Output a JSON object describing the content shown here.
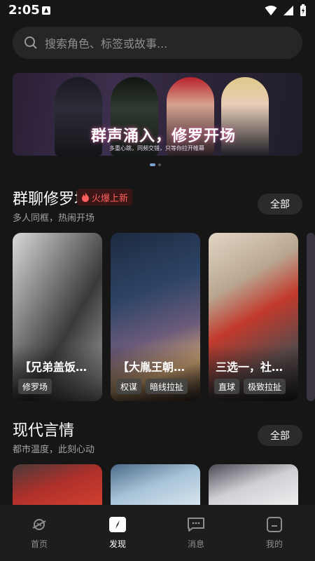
{
  "status": {
    "time": "2:05"
  },
  "search": {
    "placeholder": "搜索角色、标签或故事..."
  },
  "banner": {
    "title": "群声涌入，修罗开场",
    "subtitle": "多重心跳，同频交错，只等你拉开帷幕"
  },
  "sections": [
    {
      "title": "群聊修罗场",
      "badge": "火爆上新",
      "subtitle": "多人同框，热闹开场",
      "all_label": "全部",
      "cards": [
        {
          "title": "【兄弟盖饭…",
          "tags": [
            "修罗场"
          ]
        },
        {
          "title": "【大胤王朝…",
          "tags": [
            "权谋",
            "暗线拉扯"
          ]
        },
        {
          "title": "三选一，社…",
          "tags": [
            "直球",
            "极致拉扯"
          ]
        }
      ]
    },
    {
      "title": "现代言情",
      "subtitle": "都市温度，此刻心动",
      "all_label": "全部"
    }
  ],
  "tabs": [
    {
      "label": "首页",
      "icon": "home-planet-icon",
      "active": false
    },
    {
      "label": "发现",
      "icon": "discover-icon",
      "active": true
    },
    {
      "label": "消息",
      "icon": "message-icon",
      "active": false
    },
    {
      "label": "我的",
      "icon": "profile-icon",
      "active": false
    }
  ],
  "colors": {
    "background": "#161616",
    "badge_text": "#ff5f5f",
    "active_tab": "#ffffff",
    "inactive_tab": "#8d8d8d"
  }
}
